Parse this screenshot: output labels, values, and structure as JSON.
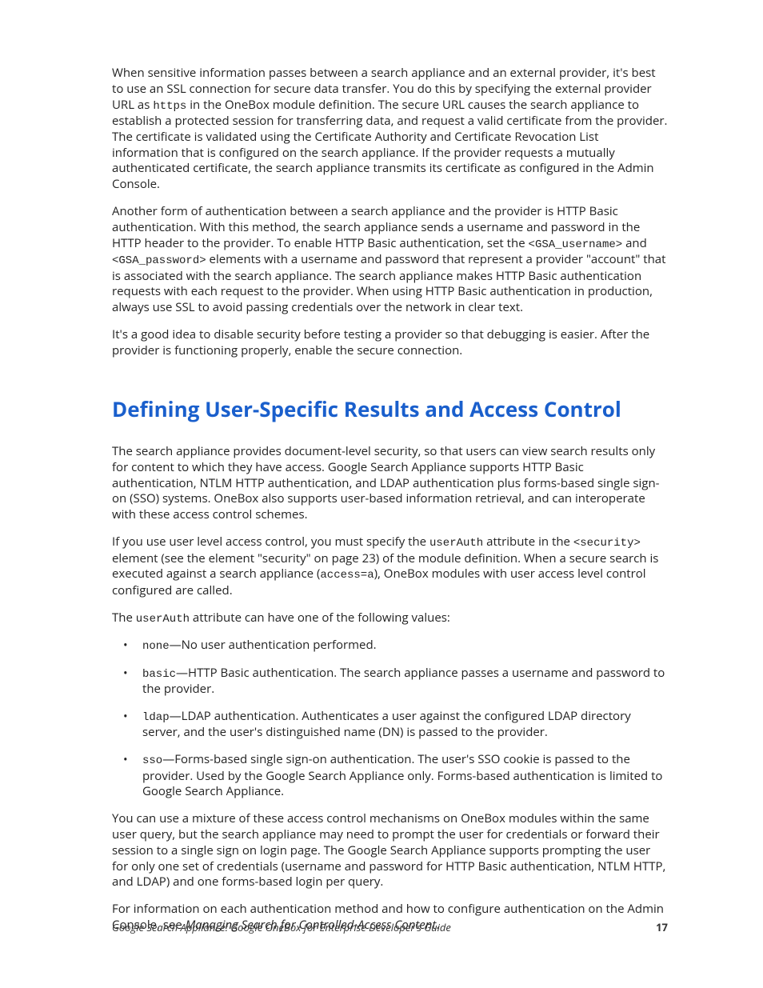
{
  "para1": {
    "a": "When sensitive information passes between a search appliance and an external provider, it's best to use an SSL connection for secure data transfer. You do this by specifying the external provider URL as ",
    "code1": "https",
    "b": " in the OneBox module definition. The secure URL causes the search appliance to establish a protected session for transferring data, and request a valid certificate from the provider. The certificate is validated using the Certificate Authority and Certificate Revocation List information that is configured on the search appliance. If the provider requests a mutually authenticated certificate, the search appliance transmits its certificate as configured in the Admin Console."
  },
  "para2": {
    "a": "Another form of authentication between a search appliance and the provider is HTTP Basic authentication. With this method, the search appliance sends a username and password in the HTTP header to the provider. To enable HTTP Basic authentication, set the ",
    "code1": "<GSA_username>",
    "b": " and ",
    "code2": "<GSA_password>",
    "c": " elements with a username and password that represent a provider \"account\" that is associated with the search appliance. The search appliance makes HTTP Basic authentication requests with each request to the provider. When using HTTP Basic authentication in production, always use SSL to avoid passing credentials over the network in clear text."
  },
  "para3": "It's a good idea to disable security before testing a provider so that debugging is easier. After the provider is functioning properly, enable the secure connection.",
  "heading": "Defining User-Specific Results and Access Control",
  "para4": "The search appliance provides document-level security, so that users can view search results only for content to which they have access. Google Search Appliance supports HTTP Basic authentication, NTLM HTTP authentication, and LDAP authentication plus forms-based single sign-on (SSO) systems. OneBox also supports user-based information retrieval, and can interoperate with these access control schemes.",
  "para5": {
    "a": "If you use user level access control, you must specify the ",
    "code1": "userAuth",
    "b": " attribute in the ",
    "code2": "<security>",
    "c": " element (see the element \"security\" on page 23) of the module definition. When a secure search is executed against a search appliance (",
    "code3": "access=a",
    "d": "), OneBox modules with user access level control configured are called."
  },
  "para6": {
    "a": "The ",
    "code1": "userAuth",
    "b": " attribute can have one of the following values:"
  },
  "bullets": [
    {
      "code": "none",
      "text": "—No user authentication performed."
    },
    {
      "code": "basic",
      "text": "—HTTP Basic authentication. The search appliance passes a username and password to the provider."
    },
    {
      "code": "ldap",
      "text": "—LDAP authentication. Authenticates a user against the configured LDAP directory server, and the user's distinguished name (DN) is passed to the provider."
    },
    {
      "code": "sso",
      "text": "—Forms-based single sign-on authentication. The user's SSO cookie is passed to the provider. Used by the Google Search Appliance only. Forms-based authentication is limited to Google Search Appliance."
    }
  ],
  "para7": "You can use a mixture of these access control mechanisms on OneBox modules within the same user query, but the search appliance may need to prompt the user for credentials or forward their session to a single sign on login page. The Google Search Appliance supports prompting the user for only one set of credentials (username and password for HTTP Basic authentication, NTLM HTTP, and LDAP) and one forms-based login per query.",
  "para8": {
    "a": "For information on each authentication method and how to configure authentication on the Admin Console, see ",
    "ref": "Managing Search for Controlled-Access Content",
    "b": "."
  },
  "footer": {
    "title": "Google Search Appliance: Google OneBox for Enterprise Developer's Guide",
    "page": "17"
  }
}
